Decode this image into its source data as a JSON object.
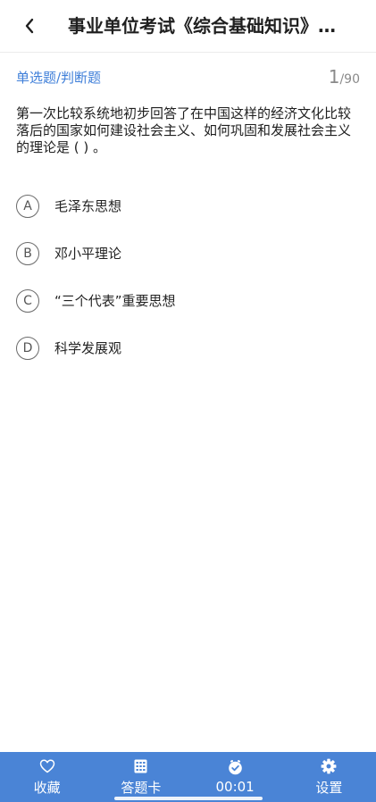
{
  "header": {
    "title": "事业单位考试《综合基础知识》…",
    "back_icon": "chevron-left-icon"
  },
  "question": {
    "type_label": "单选题/判断题",
    "current": "1",
    "separator": "/",
    "total": "90",
    "text": "第一次比较系统地初步回答了在中国这样的经济文化比较落后的国家如何建设社会主义、如何巩固和发展社会主义的理论是 ( ) 。",
    "options": [
      {
        "letter": "A",
        "text": "毛泽东思想"
      },
      {
        "letter": "B",
        "text": "邓小平理论"
      },
      {
        "letter": "C",
        "text": "“三个代表”重要思想"
      },
      {
        "letter": "D",
        "text": "科学发展观"
      }
    ]
  },
  "footer": {
    "tabs": [
      {
        "label": "收藏",
        "icon": "heart-icon"
      },
      {
        "label": "答题卡",
        "icon": "answer-card-grid-icon"
      },
      {
        "label": "00:01",
        "icon": "timer-check-icon"
      },
      {
        "label": "设置",
        "icon": "gear-icon"
      }
    ]
  },
  "colors": {
    "accent": "#3f7fd9",
    "footer_bg": "#4a84d6",
    "counter": "#8a8a8a"
  }
}
